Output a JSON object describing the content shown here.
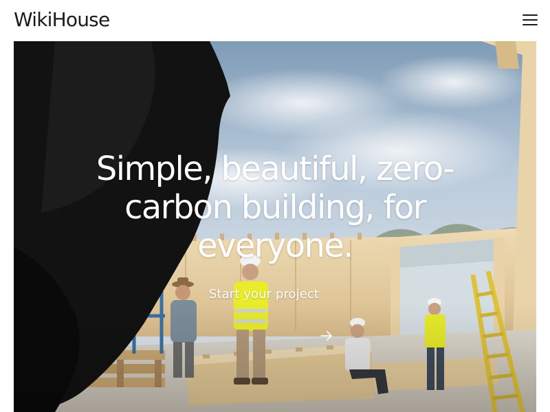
{
  "header": {
    "logo_text": "WikiHouse",
    "menu_icon": "hamburger-menu-icon"
  },
  "hero": {
    "headline": "Simple, beautiful, zero-carbon building, for everyone.",
    "cta_label": "Start your project",
    "cta_icon": "arrow-right-icon"
  },
  "colors": {
    "text": "#1a1a1a",
    "hero_text": "#ffffff",
    "plywood": "#e3c99c",
    "hi_vis": "#e6ea2a",
    "sky": "#a8bfd3"
  }
}
